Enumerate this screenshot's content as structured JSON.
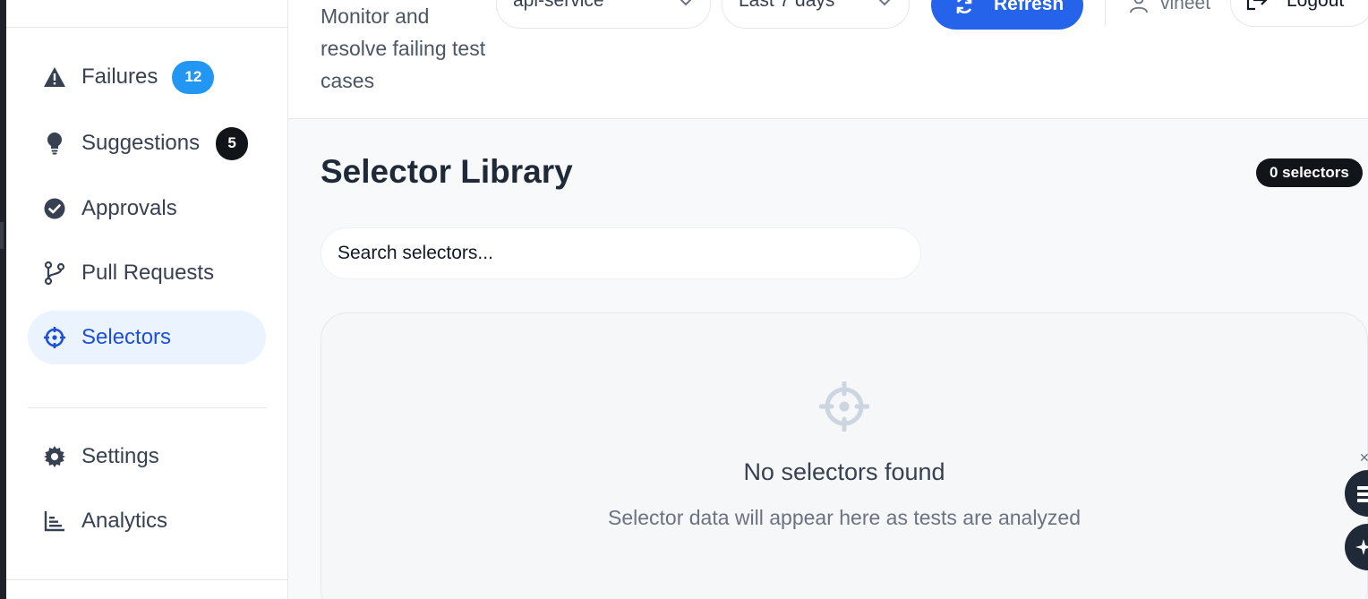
{
  "sidebar": {
    "items": [
      {
        "label": "Failures",
        "badge": "12"
      },
      {
        "label": "Suggestions",
        "badge": "5"
      },
      {
        "label": "Approvals"
      },
      {
        "label": "Pull Requests"
      },
      {
        "label": "Selectors",
        "active": true
      }
    ],
    "bottom_items": [
      {
        "label": "Settings"
      },
      {
        "label": "Analytics"
      }
    ]
  },
  "header": {
    "subtitle": "Monitor and resolve failing test cases",
    "service_select": "api-service",
    "range_select": "Last 7 days",
    "refresh_label": "Refresh",
    "user_name": "vineet",
    "logout_label": "Logout"
  },
  "main": {
    "title": "Selector Library",
    "count_label": "0 selectors",
    "search_placeholder": "Search selectors...",
    "empty_title": "No selectors found",
    "empty_description": "Selector data will appear here as tests are analyzed"
  },
  "colors": {
    "accent": "#2563eb",
    "active_bg": "#eaf3fe",
    "badge_blue": "#2196f3",
    "badge_dark": "#111418"
  },
  "icons": [
    "warning-icon",
    "lightbulb-icon",
    "check-circle-icon",
    "git-branch-icon",
    "crosshair-icon",
    "gear-icon",
    "bar-chart-icon",
    "chevron-down-icon",
    "refresh-icon",
    "user-icon",
    "logout-icon"
  ]
}
